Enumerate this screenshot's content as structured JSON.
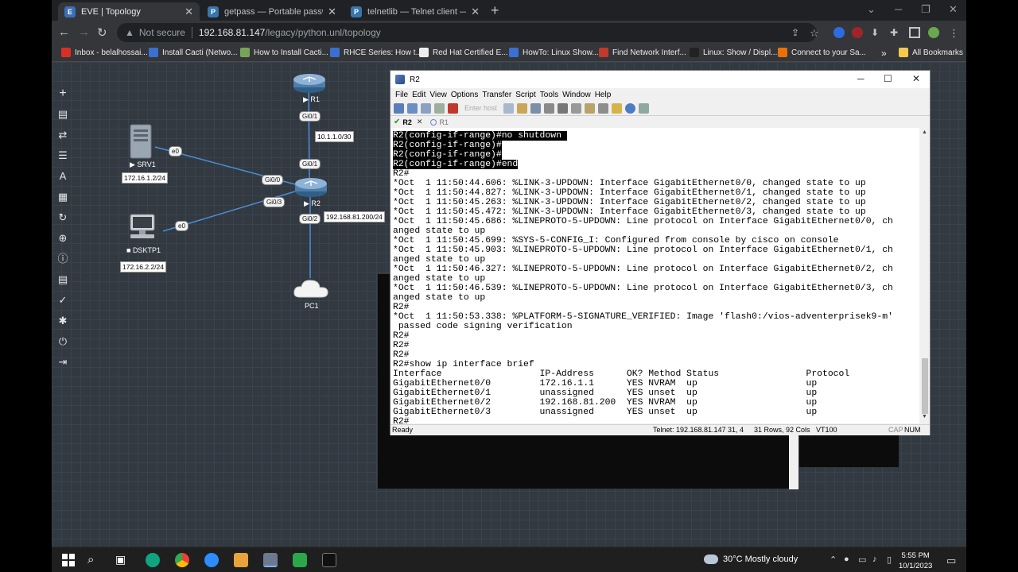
{
  "browser": {
    "tabs": [
      {
        "title": "EVE | Topology",
        "active": true
      },
      {
        "title": "getpass — Portable password in",
        "active": false
      },
      {
        "title": "telnetlib — Telnet client — Pyth",
        "active": false
      }
    ],
    "omnibox": {
      "security": "Not secure",
      "host": "192.168.81.147",
      "path": "/legacy/python.unl/topology"
    },
    "bookmarks": [
      "Inbox - belalhossai...",
      "Install Cacti (Netwo...",
      "How to Install Cacti...",
      "RHCE Series: How t...",
      "Red Hat Certified E...",
      "HowTo: Linux Show...",
      "Find Network Interf...",
      "Linux: Show / Displ...",
      "Connect to your Sa..."
    ],
    "bookmarks_more": "»",
    "all_bookmarks": "All Bookmarks"
  },
  "topology": {
    "nodes": {
      "r1": "R1",
      "r2": "R2",
      "srv1": "SRV1",
      "dsktp1": "DSKTP1",
      "pc1": "PC1"
    },
    "ips": {
      "r1_r2_link": "10.1.1.0/30",
      "srv1": "172.16.1.2/24",
      "dsktp1": "172.16.2.2/24",
      "r2_gi02": "192.168.81.200/24"
    },
    "interfaces": {
      "r1_gi01": "Gi0/1",
      "r2_gi01": "Gi0/1",
      "r2_gi00": "Gi0/0",
      "r2_gi03": "Gi0/3",
      "r2_gi02": "Gi0/2",
      "srv1_e0": "e0",
      "dsktp1_e0": "e0"
    }
  },
  "terminal_app": {
    "title": "R2",
    "menu": [
      "File",
      "Edit",
      "View",
      "Options",
      "Transfer",
      "Script",
      "Tools",
      "Window",
      "Help"
    ],
    "host_placeholder": "Enter host",
    "tabs": [
      {
        "label": "R2",
        "active": true
      },
      {
        "label": "R1",
        "active": false
      }
    ],
    "lines": [
      {
        "text": "R2(config-if-range)#no shutdown ",
        "highlight": true
      },
      {
        "text": "R2(config-if-range)#",
        "highlight": true
      },
      {
        "text": "R2(config-if-range)#",
        "highlight": true
      },
      {
        "text": "R2(config-if-range)#end",
        "highlight": true
      },
      {
        "text": "R2#",
        "highlight": false
      },
      {
        "text": "*Oct  1 11:50:44.606: %LINK-3-UPDOWN: Interface GigabitEthernet0/0, changed state to up",
        "highlight": false
      },
      {
        "text": "*Oct  1 11:50:44.827: %LINK-3-UPDOWN: Interface GigabitEthernet0/1, changed state to up",
        "highlight": false
      },
      {
        "text": "*Oct  1 11:50:45.263: %LINK-3-UPDOWN: Interface GigabitEthernet0/2, changed state to up",
        "highlight": false
      },
      {
        "text": "*Oct  1 11:50:45.472: %LINK-3-UPDOWN: Interface GigabitEthernet0/3, changed state to up",
        "highlight": false
      },
      {
        "text": "*Oct  1 11:50:45.686: %LINEPROTO-5-UPDOWN: Line protocol on Interface GigabitEthernet0/0, ch",
        "highlight": false
      },
      {
        "text": "anged state to up",
        "highlight": false
      },
      {
        "text": "*Oct  1 11:50:45.699: %SYS-5-CONFIG_I: Configured from console by cisco on console",
        "highlight": false
      },
      {
        "text": "*Oct  1 11:50:45.903: %LINEPROTO-5-UPDOWN: Line protocol on Interface GigabitEthernet0/1, ch",
        "highlight": false
      },
      {
        "text": "anged state to up",
        "highlight": false
      },
      {
        "text": "*Oct  1 11:50:46.327: %LINEPROTO-5-UPDOWN: Line protocol on Interface GigabitEthernet0/2, ch",
        "highlight": false
      },
      {
        "text": "anged state to up",
        "highlight": false
      },
      {
        "text": "*Oct  1 11:50:46.539: %LINEPROTO-5-UPDOWN: Line protocol on Interface GigabitEthernet0/3, ch",
        "highlight": false
      },
      {
        "text": "anged state to up",
        "highlight": false
      },
      {
        "text": "R2#",
        "highlight": false
      },
      {
        "text": "*Oct  1 11:50:53.338: %PLATFORM-5-SIGNATURE_VERIFIED: Image 'flash0:/vios-adventerprisek9-m'",
        "highlight": false
      },
      {
        "text": " passed code signing verification",
        "highlight": false
      },
      {
        "text": "R2#",
        "highlight": false
      },
      {
        "text": "R2#",
        "highlight": false
      },
      {
        "text": "R2#",
        "highlight": false
      },
      {
        "text": "R2#show ip interface brief",
        "highlight": false
      },
      {
        "text": "Interface                  IP-Address      OK? Method Status                Protocol",
        "highlight": false
      },
      {
        "text": "GigabitEthernet0/0         172.16.1.1      YES NVRAM  up                    up",
        "highlight": false
      },
      {
        "text": "GigabitEthernet0/1         unassigned      YES unset  up                    up",
        "highlight": false
      },
      {
        "text": "GigabitEthernet0/2         192.168.81.200  YES NVRAM  up                    up",
        "highlight": false
      },
      {
        "text": "GigabitEthernet0/3         unassigned      YES unset  up                    up",
        "highlight": false
      },
      {
        "text": "R2#",
        "highlight": false
      }
    ],
    "status": {
      "ready": "Ready",
      "connection": "Telnet: 192.168.81.147",
      "cursor": "31,  4",
      "size": "31 Rows, 92 Cols",
      "emulation": "VT100",
      "caps": "CAP",
      "num": "NUM"
    }
  },
  "taskbar": {
    "weather": "30°C  Mostly cloudy",
    "time": "5:55 PM",
    "date": "10/1/2023"
  },
  "colors": {
    "eve_bg": "#323941",
    "link": "#4a8fd6",
    "router": "#4f7fa8"
  }
}
